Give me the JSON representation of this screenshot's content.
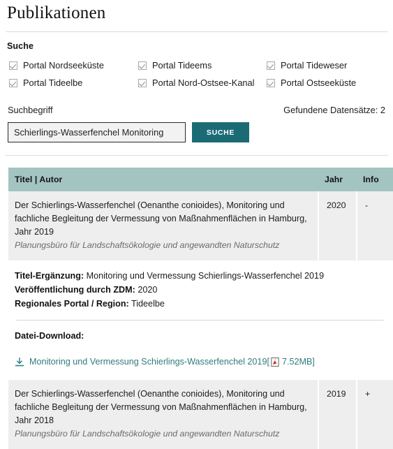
{
  "page": {
    "title": "Publikationen"
  },
  "search": {
    "section_label": "Suche",
    "portals": [
      {
        "label": "Portal Nordseeküste",
        "checked": true
      },
      {
        "label": "Portal Tideems",
        "checked": true
      },
      {
        "label": "Portal Tideweser",
        "checked": true
      },
      {
        "label": "Portal Tideelbe",
        "checked": true
      },
      {
        "label": "Portal Nord-Ostsee-Kanal",
        "checked": true
      },
      {
        "label": "Portal Ostseeküste",
        "checked": true
      }
    ],
    "term_label": "Suchbegriff",
    "term_value": "Schierlings-Wasserfenchel Monitoring",
    "term_placeholder": "Suchbegriff",
    "submit_label": "SUCHE",
    "results_count_text": "Gefundene Datensätze: 2"
  },
  "table": {
    "headers": {
      "title": "Titel | Autor",
      "year": "Jahr",
      "info": "Info"
    },
    "rows": [
      {
        "title": "Der Schierlings-Wasserfenchel (Oenanthe conioides), Monitoring und fachliche Begleitung der Vermessung von Maßnahmenflächen in Hamburg, Jahr 2019",
        "author": "Planungsbüro für Landschaftsökologie und angewandten Naturschutz",
        "year": "2020",
        "info_toggle": "-"
      },
      {
        "title": "Der Schierlings-Wasserfenchel (Oenanthe conioides), Monitoring und fachliche Begleitung der Vermessung von Maßnahmenflächen in Hamburg, Jahr 2018",
        "author": "Planungsbüro für Landschaftsökologie und angewandten Naturschutz",
        "year": "2019",
        "info_toggle": "+"
      }
    ]
  },
  "detail": {
    "subtitle_label": "Titel-Ergänzung:",
    "subtitle_value": "Monitoring und Vermessung Schierlings-Wasserfenchel 2019",
    "published_label": "Veröffentlichung durch ZDM:",
    "published_value": "2020",
    "region_label": "Regionales Portal / Region:",
    "region_value": "Tideelbe",
    "download_label": "Datei-Download:",
    "file_name": "Monitoring und Vermessung Schierlings-Wasserfenchel 2019",
    "file_bracket_open": "[",
    "file_size": "7.52MB]",
    "download_icon": "download-icon",
    "file_type_icon": "pdf-icon"
  },
  "colors": {
    "accent_button": "#1b6b75",
    "table_header": "#a3c4c1",
    "row_background": "#eeeeee",
    "link": "#2f7b82",
    "pdf_red": "#d52b1e"
  }
}
